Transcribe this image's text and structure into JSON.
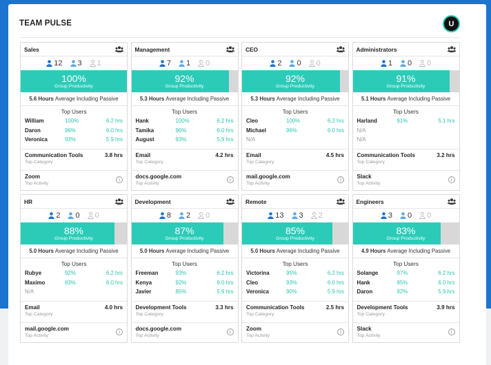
{
  "page": {
    "title": "TEAM PULSE",
    "avatar_initial": "U"
  },
  "colors": {
    "accent": "#2ccbb8",
    "brand_blue": "#1d74d0",
    "active_user": "#1e73d2",
    "idle_user": "#5aa9e6",
    "passive_user": "#b8b8b8"
  },
  "labels": {
    "group_productivity": "Group Productivity",
    "avg_suffix": "Average Including Passive",
    "top_users": "Top Users",
    "top_category": "Top Category",
    "top_activity": "Top Activity"
  },
  "teams": [
    {
      "name": "Sales",
      "active": 12,
      "idle": 3,
      "passive": 1,
      "productivity": "100%",
      "productivity_fraction": 1.0,
      "hours": "5.6 Hours",
      "users": [
        {
          "name": "William",
          "pct": "100%",
          "hrs": "6.2 hrs"
        },
        {
          "name": "Daron",
          "pct": "96%",
          "hrs": "6.0 hrs"
        },
        {
          "name": "Veronica",
          "pct": "93%",
          "hrs": "5.9 hrs"
        }
      ],
      "category": "Communication Tools",
      "category_hrs": "3.8 hrs",
      "activity": "Zoom"
    },
    {
      "name": "Management",
      "active": 7,
      "idle": 1,
      "passive": 0,
      "productivity": "92%",
      "productivity_fraction": 0.92,
      "hours": "5.3 Hours",
      "users": [
        {
          "name": "Hank",
          "pct": "100%",
          "hrs": "6.2 hrs"
        },
        {
          "name": "Tamika",
          "pct": "96%",
          "hrs": "6.0 hrs"
        },
        {
          "name": "August",
          "pct": "93%",
          "hrs": "5.9 hrs"
        }
      ],
      "category": "Email",
      "category_hrs": "4.2 hrs",
      "activity": "docs.google.com"
    },
    {
      "name": "CEO",
      "active": 2,
      "idle": 0,
      "passive": 0,
      "productivity": "92%",
      "productivity_fraction": 0.92,
      "hours": "5.3 Hours",
      "users": [
        {
          "name": "Cleo",
          "pct": "100%",
          "hrs": "6.2 hrs"
        },
        {
          "name": "Michael",
          "pct": "96%",
          "hrs": "6.0 hrs"
        },
        {
          "name": "N/A",
          "pct": "",
          "hrs": ""
        }
      ],
      "category": "Email",
      "category_hrs": "4.5 hrs",
      "activity": "mail.google.com"
    },
    {
      "name": "Administrators",
      "active": 1,
      "idle": 0,
      "passive": 0,
      "productivity": "91%",
      "productivity_fraction": 0.91,
      "hours": "5.1 Hours",
      "users": [
        {
          "name": "Harland",
          "pct": "91%",
          "hrs": "5.1 hrs"
        },
        {
          "name": "N/A",
          "pct": "",
          "hrs": ""
        },
        {
          "name": "N/A",
          "pct": "",
          "hrs": ""
        }
      ],
      "category": "Communication Tools",
      "category_hrs": "3.2 hrs",
      "activity": "Slack"
    },
    {
      "name": "HR",
      "active": 2,
      "idle": 0,
      "passive": 0,
      "productivity": "88%",
      "productivity_fraction": 0.88,
      "hours": "5.0 Hours",
      "users": [
        {
          "name": "Rubye",
          "pct": "92%",
          "hrs": "6.2 hrs"
        },
        {
          "name": "Maximo",
          "pct": "83%",
          "hrs": "6.0 hrs"
        },
        {
          "name": "N/A",
          "pct": "",
          "hrs": ""
        }
      ],
      "category": "Email",
      "category_hrs": "4.0 hrs",
      "activity": "mail.google.com"
    },
    {
      "name": "Development",
      "active": 8,
      "idle": 2,
      "passive": 0,
      "productivity": "87%",
      "productivity_fraction": 0.87,
      "hours": "5.0 Hours",
      "users": [
        {
          "name": "Freeman",
          "pct": "93%",
          "hrs": "6.2 hrs"
        },
        {
          "name": "Kenya",
          "pct": "92%",
          "hrs": "6.0 hrs"
        },
        {
          "name": "Javier",
          "pct": "85%",
          "hrs": "5.9 hrs"
        }
      ],
      "category": "Development Tools",
      "category_hrs": "3.3 hrs",
      "activity": "docs.google.com"
    },
    {
      "name": "Remote",
      "active": 13,
      "idle": 3,
      "passive": 2,
      "productivity": "85%",
      "productivity_fraction": 0.85,
      "hours": "5.0 Hours",
      "users": [
        {
          "name": "Victorina",
          "pct": "95%",
          "hrs": "6.2 hrs"
        },
        {
          "name": "Cleo",
          "pct": "93%",
          "hrs": "6.0 hrs"
        },
        {
          "name": "Veronica",
          "pct": "90%",
          "hrs": "5.9 hrs"
        }
      ],
      "category": "Communication Tools",
      "category_hrs": "2.5 hrs",
      "activity": "Zoom"
    },
    {
      "name": "Engineers",
      "active": 3,
      "idle": 0,
      "passive": 0,
      "productivity": "83%",
      "productivity_fraction": 0.83,
      "hours": "4.9 Hours",
      "users": [
        {
          "name": "Solange",
          "pct": "97%",
          "hrs": "6.2 hrs"
        },
        {
          "name": "Hank",
          "pct": "95%",
          "hrs": "6.0 hrs"
        },
        {
          "name": "Daron",
          "pct": "92%",
          "hrs": "5.9 hrs"
        }
      ],
      "category": "Development Tools",
      "category_hrs": "3.9 hrs",
      "activity": "Slack"
    }
  ]
}
